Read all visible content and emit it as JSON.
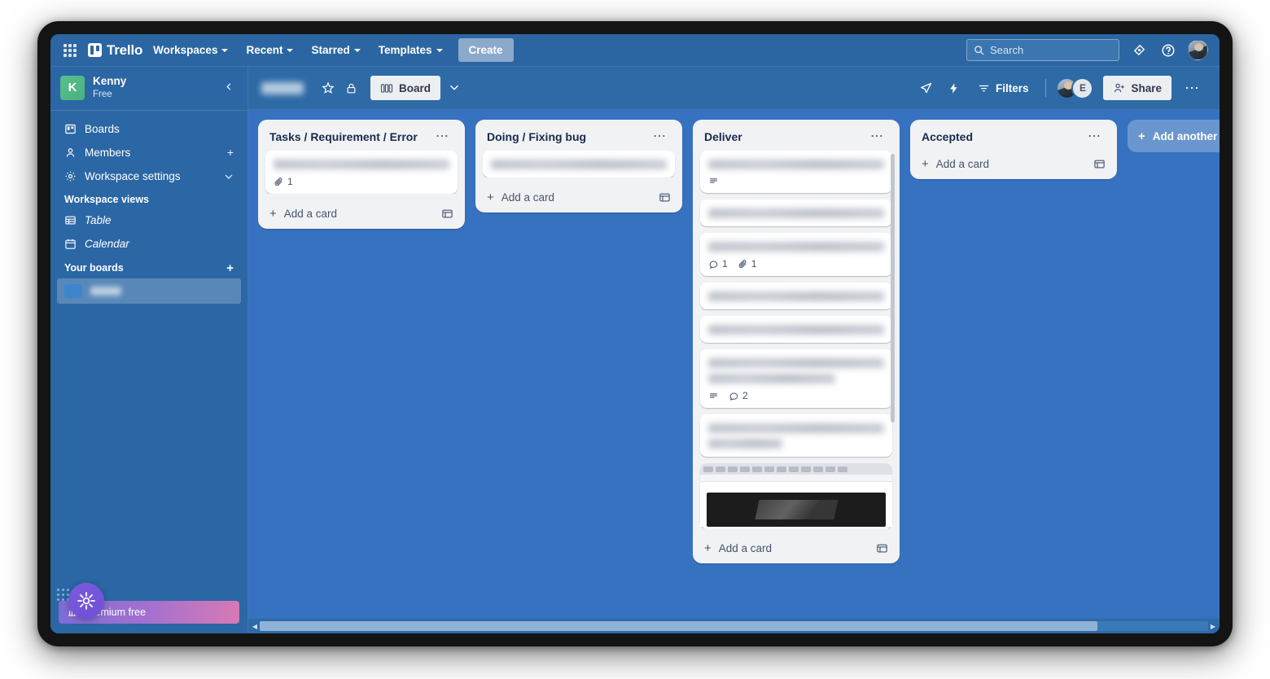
{
  "topnav": {
    "apps_icon": "grid-apps-icon",
    "brand": "Trello",
    "items": [
      {
        "label": "Workspaces",
        "has_chevron": true
      },
      {
        "label": "Recent",
        "has_chevron": true
      },
      {
        "label": "Starred",
        "has_chevron": true
      },
      {
        "label": "Templates",
        "has_chevron": true
      }
    ],
    "create_label": "Create",
    "search_placeholder": "Search",
    "search_value": "",
    "notifications_icon": "notification-bell-icon",
    "help_icon": "help-circle-icon",
    "avatar": "user-avatar"
  },
  "sidebar": {
    "workspace": {
      "initial": "K",
      "name": "Kenny",
      "plan": "Free",
      "collapse_icon": "chevron-left-icon"
    },
    "nav": [
      {
        "label": "Boards",
        "icon": "board-icon",
        "trailing": ""
      },
      {
        "label": "Members",
        "icon": "member-icon",
        "trailing": "+"
      },
      {
        "label": "Workspace settings",
        "icon": "gear-icon",
        "trailing": "∨"
      }
    ],
    "views_heading": "Workspace views",
    "views": [
      {
        "label": "Table",
        "icon": "table-icon"
      },
      {
        "label": "Calendar",
        "icon": "calendar-icon"
      }
    ],
    "boards_heading": "Your boards",
    "boards_add": "+",
    "boards": [
      {
        "label": "",
        "redacted": true
      }
    ],
    "premium": {
      "label": "Premium free",
      "badge_icon": "premium-star-icon"
    }
  },
  "boardbar": {
    "title": "",
    "title_redacted": true,
    "star_icon": "star-icon",
    "visibility_icon": "lock-icon",
    "view_label": "Board",
    "view_icon": "board-view-icon",
    "view_chevron": "chevron-down-icon",
    "rocket_icon": "rocket-icon",
    "automation_icon": "lightning-bolt-icon",
    "filters_label": "Filters",
    "filters_icon": "filter-icon",
    "members": [
      {
        "type": "photo",
        "initial": ""
      },
      {
        "type": "initial",
        "initial": "E"
      }
    ],
    "share_label": "Share",
    "share_icon": "person-add-icon",
    "more_icon": "more-horizontal-icon"
  },
  "board": {
    "add_list_label": "Add another list",
    "add_card_label": "Add a card",
    "card_template_icon": "card-template-icon",
    "list_more_icon": "list-actions-icon",
    "lists": [
      {
        "title": "Tasks / Requirement / Error",
        "cards": [
          {
            "title": "",
            "redacted": true,
            "lines": 1,
            "badges": [
              {
                "icon": "attachment-icon",
                "count": "1"
              }
            ]
          }
        ]
      },
      {
        "title": "Doing / Fixing bug",
        "cards": [
          {
            "title": "",
            "redacted": true,
            "lines": 1,
            "badges": []
          }
        ]
      },
      {
        "title": "Deliver",
        "scrollable": true,
        "cards": [
          {
            "title": "",
            "redacted": true,
            "lines": 1,
            "badges": [
              {
                "icon": "description-icon",
                "count": ""
              }
            ]
          },
          {
            "title": "",
            "redacted": true,
            "lines": 1,
            "badges": []
          },
          {
            "title": "",
            "redacted": true,
            "lines": 1,
            "badges": [
              {
                "icon": "comment-icon",
                "count": "1"
              },
              {
                "icon": "attachment-icon",
                "count": "1"
              }
            ]
          },
          {
            "title": "",
            "redacted": true,
            "lines": 1,
            "badges": []
          },
          {
            "title": "",
            "redacted": true,
            "lines": 1,
            "badges": []
          },
          {
            "title": "",
            "redacted": true,
            "lines": 2,
            "badges": [
              {
                "icon": "description-icon",
                "count": ""
              },
              {
                "icon": "comment-icon",
                "count": "2"
              }
            ]
          },
          {
            "title": "",
            "redacted": true,
            "lines": 2,
            "badges": []
          },
          {
            "title": "",
            "redacted": true,
            "lines": 0,
            "cover": "screenshot-cover",
            "badges": []
          }
        ]
      },
      {
        "title": "Accepted",
        "cards": []
      }
    ]
  },
  "scrollbar": {
    "left_arrow": "scroll-left-arrow",
    "right_arrow": "scroll-right-arrow",
    "thumb_percent": "88"
  }
}
